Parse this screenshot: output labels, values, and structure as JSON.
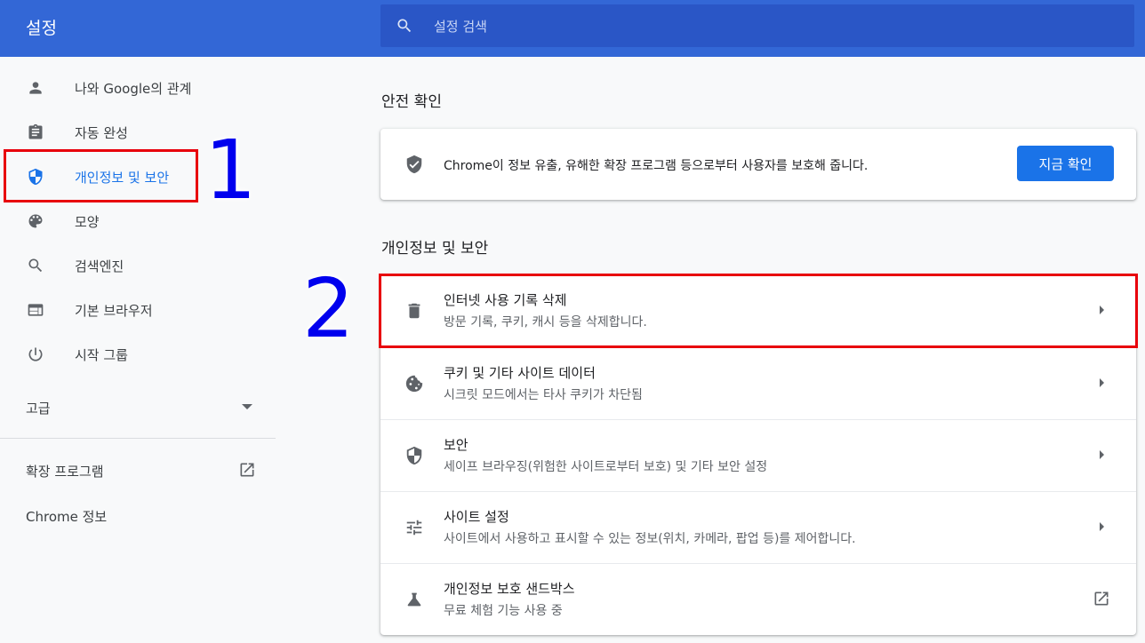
{
  "header": {
    "title": "설정",
    "search_placeholder": "설정 검색",
    "background": "#3367d6"
  },
  "sidebar": {
    "items": [
      {
        "label": "나와 Google의 관계",
        "icon": "person-icon"
      },
      {
        "label": "자동 완성",
        "icon": "clipboard-icon"
      },
      {
        "label": "개인정보 및 보안",
        "icon": "shield-icon",
        "active": true
      },
      {
        "label": "모양",
        "icon": "palette-icon"
      },
      {
        "label": "검색엔진",
        "icon": "search-icon"
      },
      {
        "label": "기본 브라우저",
        "icon": "browser-window-icon"
      },
      {
        "label": "시작 그룹",
        "icon": "power-icon"
      }
    ],
    "advanced_label": "고급",
    "extensions_label": "확장 프로그램",
    "about_label": "Chrome 정보"
  },
  "main": {
    "safety_check": {
      "section_title": "안전 확인",
      "text": "Chrome이 정보 유출, 유해한 확장 프로그램 등으로부터 사용자를 보호해 줍니다.",
      "button_label": "지금 확인"
    },
    "privacy": {
      "section_title": "개인정보 및 보안",
      "rows": [
        {
          "title": "인터넷 사용 기록 삭제",
          "subtitle": "방문 기록, 쿠키, 캐시 등을 삭제합니다.",
          "icon": "trash-icon"
        },
        {
          "title": "쿠키 및 기타 사이트 데이터",
          "subtitle": "시크릿 모드에서는 타사 쿠키가 차단됨",
          "icon": "cookie-icon"
        },
        {
          "title": "보안",
          "subtitle": "세이프 브라우징(위험한 사이트로부터 보호) 및 기타 보안 설정",
          "icon": "shield-icon"
        },
        {
          "title": "사이트 설정",
          "subtitle": "사이트에서 사용하고 표시할 수 있는 정보(위치, 카메라, 팝업 등)를 제어합니다.",
          "icon": "sliders-icon"
        },
        {
          "title": "개인정보 보호 샌드박스",
          "subtitle": "무료 체험 기능 사용 중",
          "icon": "flask-icon"
        }
      ]
    }
  },
  "annotations": {
    "marker_1": "1",
    "marker_2": "2",
    "box_color": "#e8000b",
    "number_color": "#0000ee"
  },
  "colors": {
    "accent": "#1a73e8",
    "icon": "#5f6368"
  }
}
